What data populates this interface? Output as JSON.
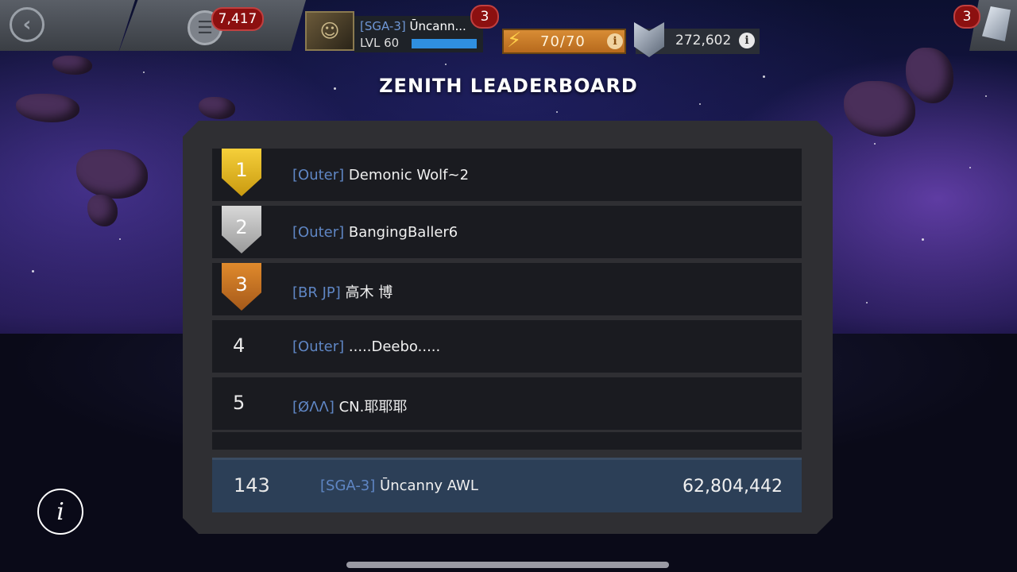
{
  "topbar": {
    "alerts_count": "7,417",
    "profile": {
      "tag": "[SGA-3]",
      "name": "Ūncann...",
      "level": "LVL 60",
      "xp_fraction": 1.0,
      "badge": "3"
    },
    "energy": {
      "value": "70/70"
    },
    "units": {
      "value": "272,602"
    },
    "crystals_badge": "3"
  },
  "title": "ZENITH LEADERBOARD",
  "leaderboard": {
    "rows": [
      {
        "rank": "1",
        "tag": "[Outer]",
        "name": "Demonic Wolf~2",
        "medal": "gold"
      },
      {
        "rank": "2",
        "tag": "[Outer]",
        "name": "BangingBaller6",
        "medal": "silver"
      },
      {
        "rank": "3",
        "tag": "[BR JP]",
        "name": "高木 博",
        "medal": "bronze"
      },
      {
        "rank": "4",
        "tag": "[Outer]",
        "name": ".....Deebo.....",
        "medal": ""
      },
      {
        "rank": "5",
        "tag": "[ØΛΛ]",
        "name": "CN.耶耶耶",
        "medal": ""
      }
    ],
    "me": {
      "rank": "143",
      "tag": "[SGA-3]",
      "name": "Ūncanny AWL",
      "score": "62,804,442"
    }
  },
  "icons": {
    "back": "back-arrow-icon",
    "menu": "menu-icon",
    "energy": "lightning-icon",
    "units": "units-icon",
    "crystals": "crystal-icon",
    "info": "info-icon"
  },
  "colors": {
    "gold": "#f5cf3a",
    "silver": "#c8c8c8",
    "bronze": "#d97c26",
    "alliance_tag": "#5f86c4",
    "my_row": "#2c3f57",
    "energy": "#d88c35"
  }
}
